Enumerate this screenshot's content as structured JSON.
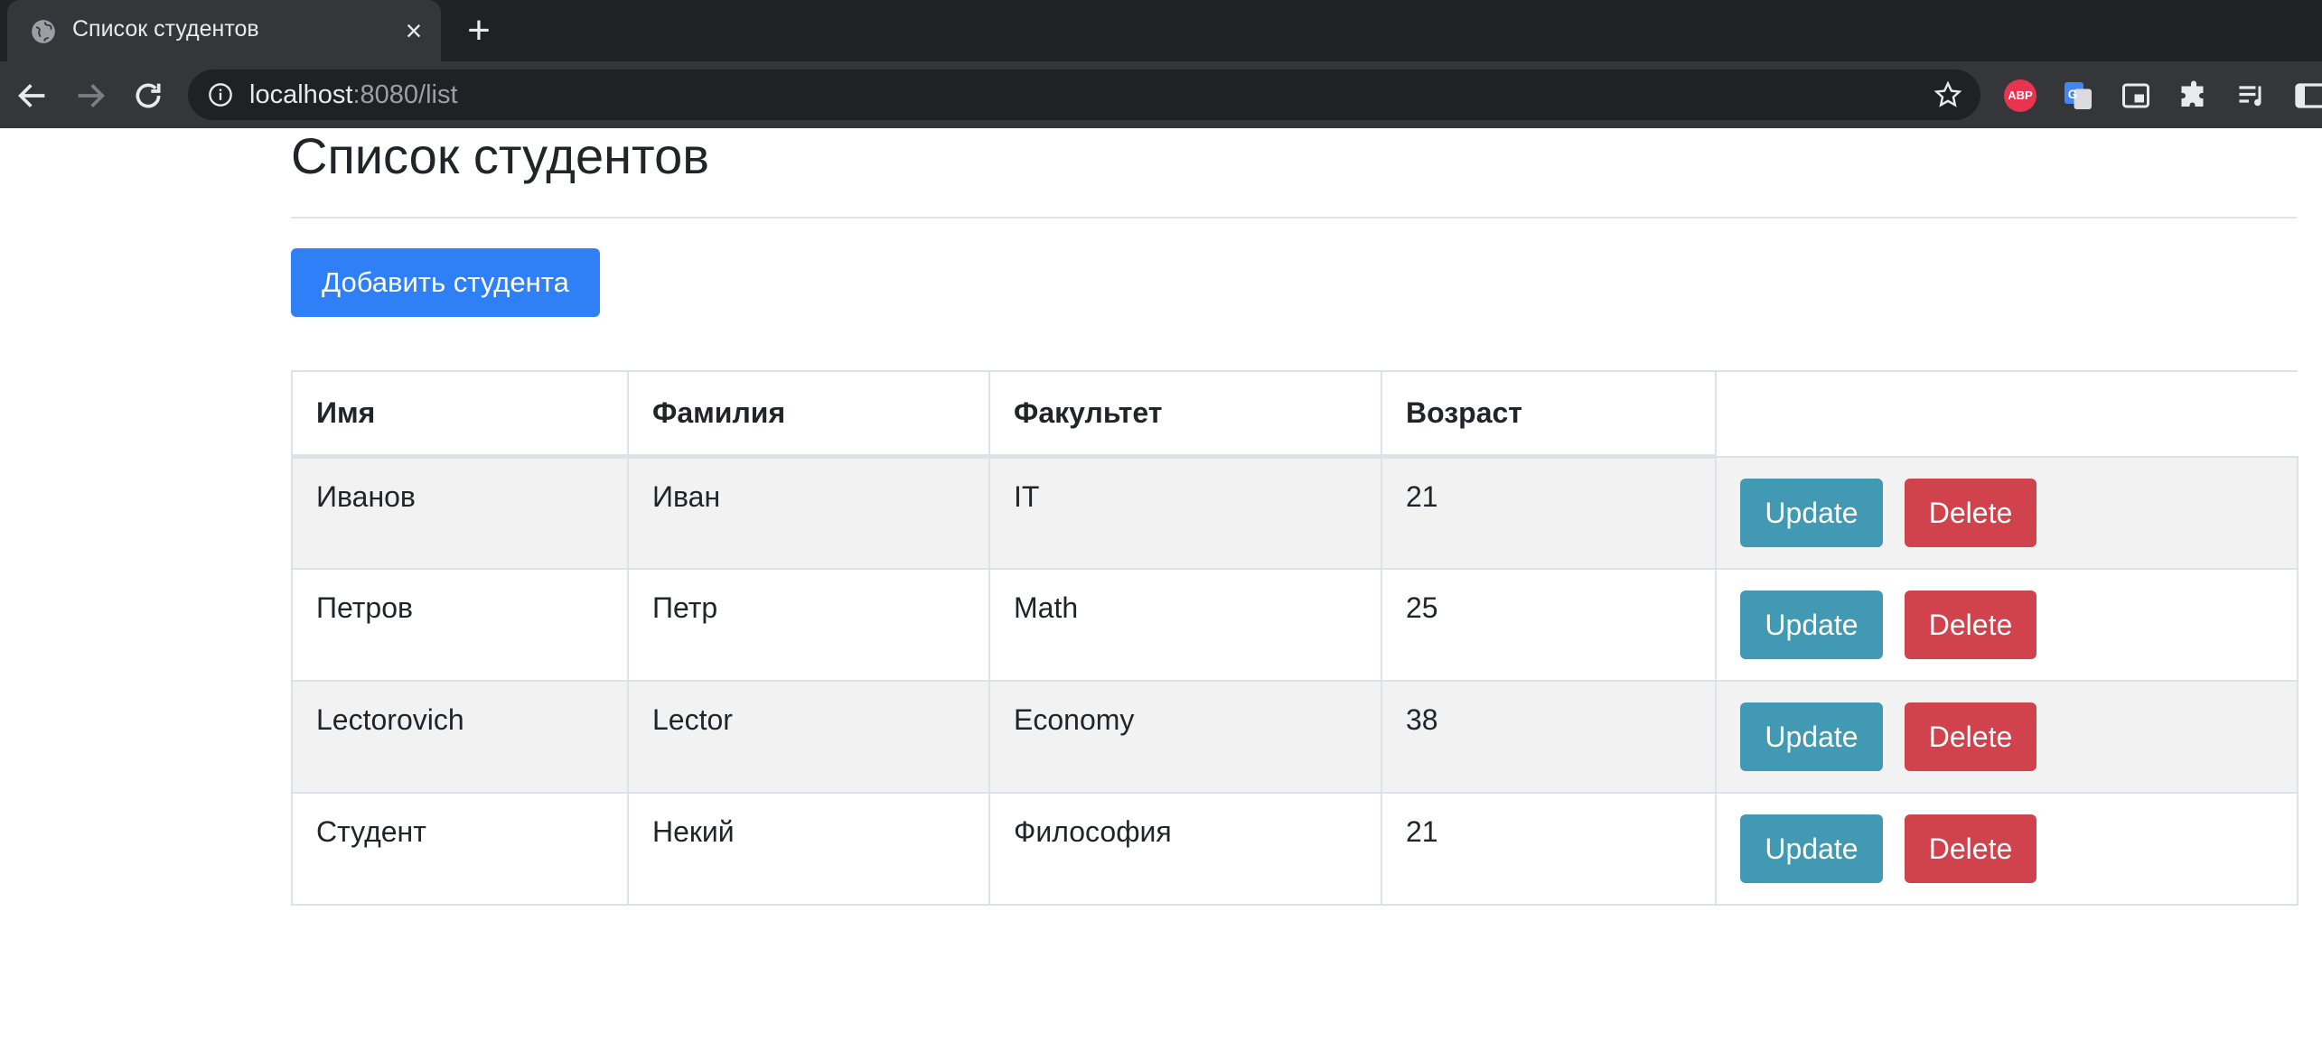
{
  "browser": {
    "tab_title": "Список студентов",
    "url_host": "localhost",
    "url_rest": ":8080/list",
    "extensions": [
      "abp-icon",
      "google-translate-icon",
      "picture-in-picture-icon",
      "puzzle-extensions-icon",
      "media-queue-icon",
      "side-panel-icon"
    ],
    "abp_label": "ABP"
  },
  "page": {
    "title": "Список студентов",
    "add_button": "Добавить студента"
  },
  "table": {
    "headers": [
      "Имя",
      "Фамилия",
      "Факультет",
      "Возраст"
    ],
    "rows": [
      {
        "first": "Иванов",
        "last": "Иван",
        "faculty": "IT",
        "age": "21"
      },
      {
        "first": "Петров",
        "last": "Петр",
        "faculty": "Math",
        "age": "25"
      },
      {
        "first": "Lectorovich",
        "last": "Lector",
        "faculty": "Economy",
        "age": "38"
      },
      {
        "first": "Студент",
        "last": "Некий",
        "faculty": "Философия",
        "age": "21"
      }
    ],
    "update_label": "Update",
    "delete_label": "Delete"
  },
  "colors": {
    "primary": "#2f80f7",
    "info": "#4299b4",
    "danger": "#d1434c",
    "stripe": "#f2f2f2"
  }
}
